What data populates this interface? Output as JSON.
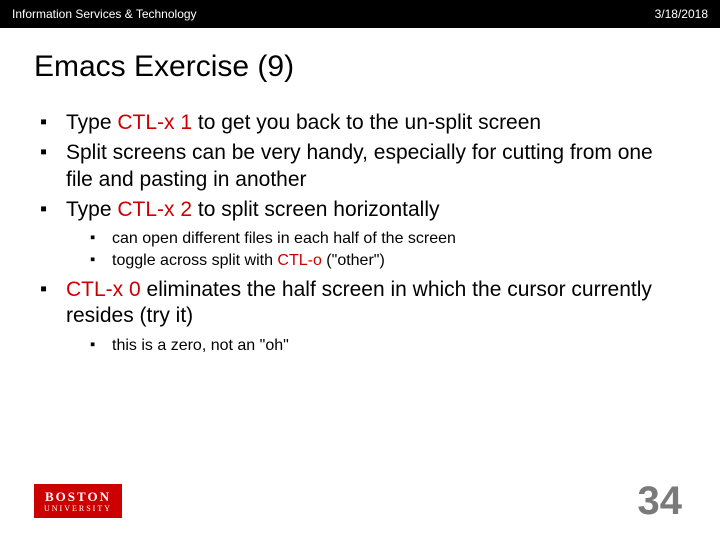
{
  "header": {
    "left": "Information Services & Technology",
    "right": "3/18/2018"
  },
  "title": "Emacs Exercise (9)",
  "bullets": {
    "b1_pre": "Type ",
    "b1_cmd": "CTL-x 1",
    "b1_post": " to get you back to the un-split screen",
    "b2": "Split screens can be very handy, especially for cutting from one file and pasting in another",
    "b3_pre": "Type ",
    "b3_cmd": "CTL-x 2",
    "b3_post": " to split screen horizontally",
    "b3_sub1": "can open different files in each half of the screen",
    "b3_sub2_pre": "toggle across split with ",
    "b3_sub2_cmd": "CTL-o",
    "b3_sub2_post": " (\"other\")",
    "b4_cmd": "CTL-x 0",
    "b4_post": " eliminates the half screen in which the cursor currently resides (try it)",
    "b4_sub1": "this is a zero, not an \"oh\""
  },
  "logo": {
    "line1": "BOSTON",
    "line2": "UNIVERSITY"
  },
  "page_number": "34"
}
